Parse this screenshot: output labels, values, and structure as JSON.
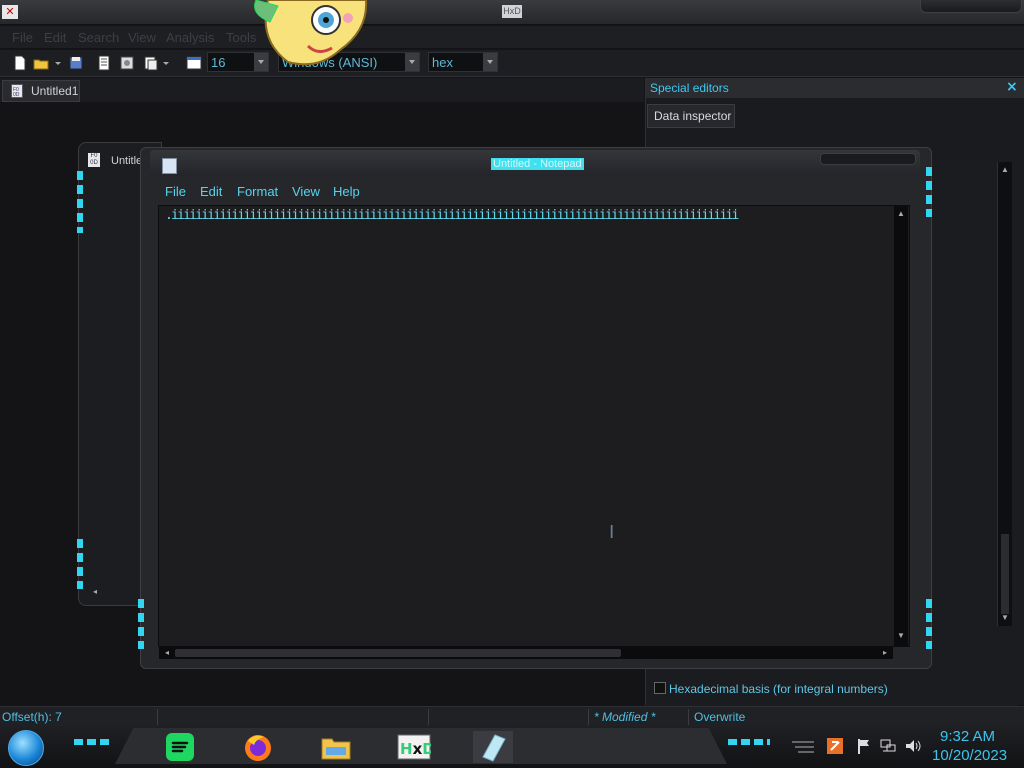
{
  "hxd": {
    "app_icon_text": "✕",
    "title_text": "HxD",
    "menu": [
      "File",
      "Edit",
      "Search",
      "View",
      "Analysis",
      "Tools"
    ],
    "toolbar": {
      "bytes_per_row": "16",
      "charset": "Windows (ANSI)",
      "offset_base": "hex"
    },
    "doc_tab": "Untitled1",
    "child_window_title": "Untitle",
    "special_editors": {
      "title": "Special editors",
      "close": "×",
      "tab": "Data inspector",
      "hex_basis_label": "Hexadecimal basis (for integral numbers)"
    },
    "statusbar": {
      "offset": "Offset(h): 7",
      "modified": "* Modified *",
      "mode": "Overwrite"
    }
  },
  "notepad": {
    "title": "Untitled - Notepad",
    "menu": [
      "File",
      "Edit",
      "Format",
      "View",
      "Help"
    ],
    "text": ".iiiiiiiiiiiiiiiiiiiiiiiiiiiiiiiiiiiiiiiiiiiiiiiiiiiiiiiiiiiiiiiiiiiiiiiiiiiiiiiiiiiiiiiiiiiiii"
  },
  "taskbar": {
    "apps": [
      "spotify-icon",
      "firefox-icon",
      "file-explorer-icon",
      "hxd-icon",
      "notepad-icon"
    ],
    "time": "9:32 AM",
    "date": "10/20/2023"
  },
  "colors": {
    "accent": "#3fc8f2",
    "background": "#141416"
  }
}
